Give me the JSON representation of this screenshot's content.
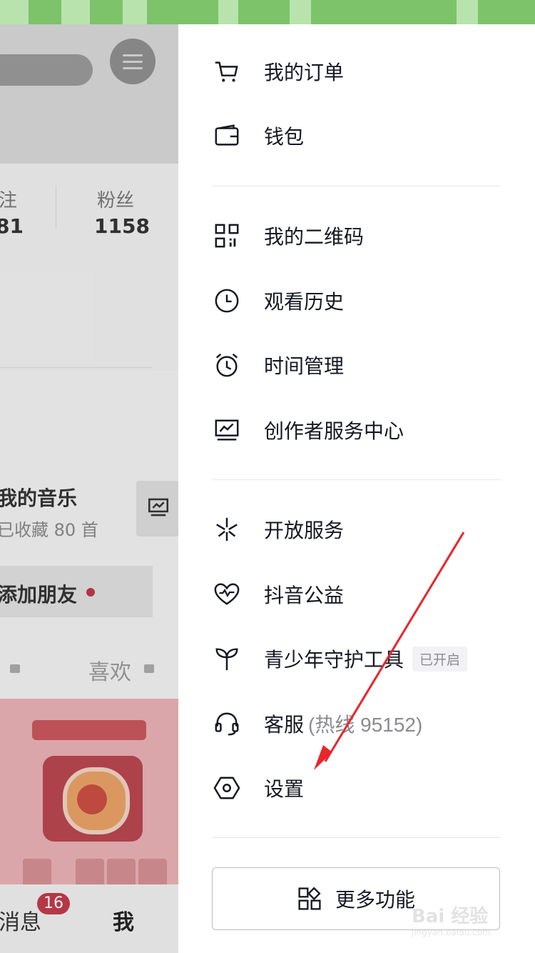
{
  "background": {
    "stats": [
      {
        "label": "注",
        "value": "81"
      },
      {
        "label": "粉丝",
        "value": "1158"
      }
    ],
    "music_title": "我的音乐",
    "music_sub": "已收藏 80 首",
    "add_friend": "添加朋友",
    "tab_like": "喜欢",
    "tab_messages": "消息",
    "tab_messages_badge": "16",
    "tab_me": "我"
  },
  "drawer": {
    "items": [
      {
        "label": "我的订单",
        "icon": "cart-icon"
      },
      {
        "label": "钱包",
        "icon": "wallet-icon"
      },
      {
        "label": "我的二维码",
        "icon": "qrcode-icon"
      },
      {
        "label": "观看历史",
        "icon": "clock-icon"
      },
      {
        "label": "时间管理",
        "icon": "alarm-clock-icon"
      },
      {
        "label": "创作者服务中心",
        "icon": "monitor-chart-icon"
      },
      {
        "label": "开放服务",
        "icon": "open-service-icon"
      },
      {
        "label": "抖音公益",
        "icon": "charity-heart-icon"
      },
      {
        "label": "青少年守护工具",
        "icon": "sprout-icon",
        "badge": "已开启"
      },
      {
        "label": "客服",
        "hotline": "(热线 95152)",
        "icon": "headset-icon"
      },
      {
        "label": "设置",
        "icon": "hexagon-settings-icon"
      }
    ],
    "more_button": "更多功能"
  },
  "colors": {
    "status_bar": "#7cc36a",
    "arrow": "#e8262c",
    "badge": "#c03c4b"
  },
  "watermark": {
    "main": "Bai 经验",
    "sub": "jingyan.baidu.com"
  }
}
